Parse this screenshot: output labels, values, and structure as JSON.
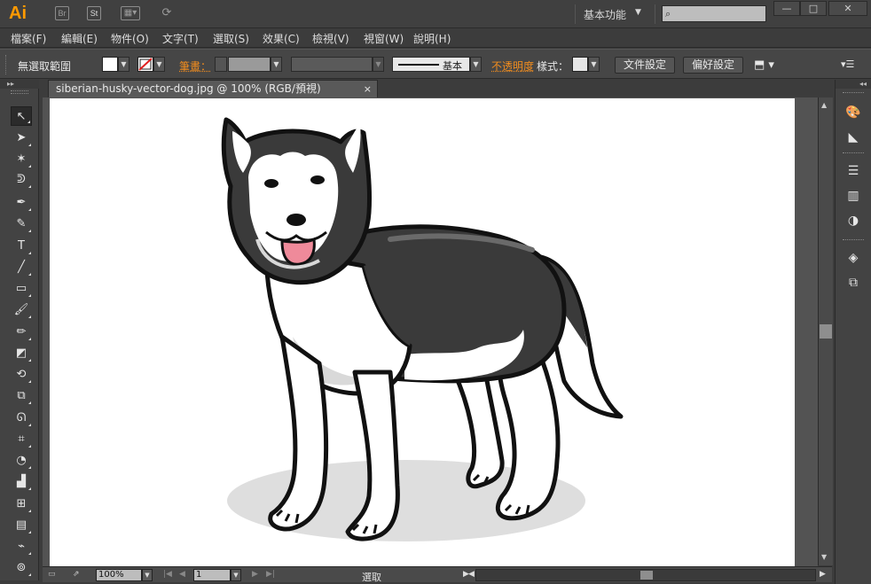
{
  "app": {
    "logo": "Ai",
    "bridge_label": "Br",
    "stock_label": "St",
    "workspace": "基本功能",
    "search_placeholder": ""
  },
  "window_controls": {
    "minimize": "—",
    "maximize": "□",
    "close": "✕"
  },
  "menu": [
    "檔案(F)",
    "編輯(E)",
    "物件(O)",
    "文字(T)",
    "選取(S)",
    "效果(C)",
    "檢視(V)",
    "視窗(W)",
    "說明(H)"
  ],
  "control_bar": {
    "no_selection": "無選取範圍",
    "stroke_label": "筆畫：",
    "stroke_style": "基本",
    "opacity_label": "不透明度",
    "style_label": "樣式：",
    "doc_setup_button": "文件設定",
    "preferences_button": "偏好設定"
  },
  "document": {
    "tab_title": "siberian-husky-vector-dog.jpg @ 100% (RGB/預視)",
    "tab_close": "×"
  },
  "status_bar": {
    "zoom": "100%",
    "page": "1",
    "tool_status": "選取"
  },
  "tools": [
    {
      "name": "selection-tool",
      "glyph": "↖"
    },
    {
      "name": "direct-selection-tool",
      "glyph": "➤"
    },
    {
      "name": "magic-wand-tool",
      "glyph": "✶"
    },
    {
      "name": "lasso-tool",
      "glyph": "ᕲ"
    },
    {
      "name": "pen-tool",
      "glyph": "✒"
    },
    {
      "name": "curvature-tool",
      "glyph": "✎"
    },
    {
      "name": "type-tool",
      "glyph": "T"
    },
    {
      "name": "line-tool",
      "glyph": "╱"
    },
    {
      "name": "rectangle-tool",
      "glyph": "▭"
    },
    {
      "name": "paintbrush-tool",
      "glyph": "🖌"
    },
    {
      "name": "pencil-tool",
      "glyph": "✏"
    },
    {
      "name": "eraser-tool",
      "glyph": "◩"
    },
    {
      "name": "rotate-tool",
      "glyph": "⟲"
    },
    {
      "name": "scale-tool",
      "glyph": "⧉"
    },
    {
      "name": "warp-tool",
      "glyph": "ᘏ"
    },
    {
      "name": "free-transform-tool",
      "glyph": "⌗"
    },
    {
      "name": "shape-builder-tool",
      "glyph": "◔"
    },
    {
      "name": "graph-tool",
      "glyph": "▟"
    },
    {
      "name": "mesh-tool",
      "glyph": "⊞"
    },
    {
      "name": "gradient-tool",
      "glyph": "▤"
    },
    {
      "name": "eyedropper-tool",
      "glyph": "⌁"
    },
    {
      "name": "blend-tool",
      "glyph": "⊚"
    }
  ],
  "right_panels": [
    {
      "name": "color-panel-icon",
      "glyph": "🎨"
    },
    {
      "name": "color-guide-icon",
      "glyph": "◣"
    },
    {
      "name": "stroke-panel-icon",
      "glyph": "☰"
    },
    {
      "name": "gradient-panel-icon",
      "glyph": "▥"
    },
    {
      "name": "transparency-panel-icon",
      "glyph": "◑"
    },
    {
      "name": "layers-panel-icon",
      "glyph": "◈"
    },
    {
      "name": "artboards-panel-icon",
      "glyph": "⧉"
    }
  ],
  "colors": {
    "accent_orange": "#ff9a00",
    "label_orange": "#f08c1e",
    "ui_dark": "#3c3c3c",
    "canvas": "#ffffff",
    "fur_dark": "#3a3a3a",
    "tongue": "#ef8a9a"
  }
}
